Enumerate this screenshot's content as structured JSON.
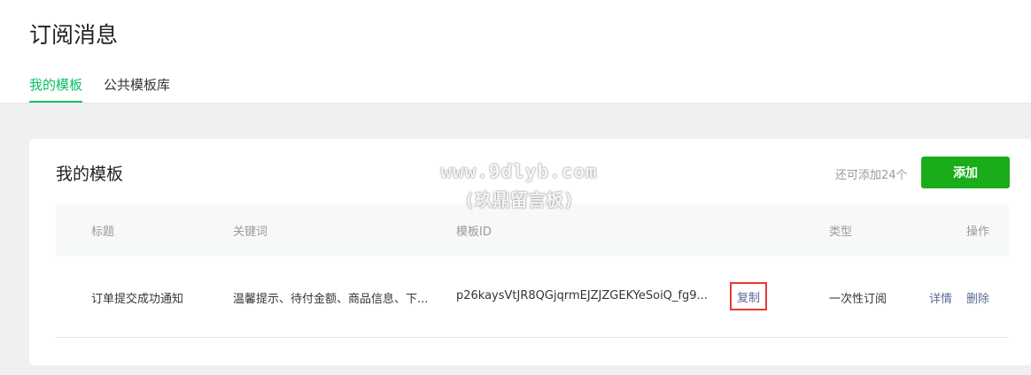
{
  "page": {
    "title": "订阅消息",
    "tabs": [
      {
        "label": "我的模板",
        "active": true
      },
      {
        "label": "公共模板库",
        "active": false
      }
    ]
  },
  "card": {
    "title": "我的模板",
    "remaining_text": "还可添加24个",
    "add_label": "添加"
  },
  "table": {
    "columns": [
      "标题",
      "关键词",
      "模板ID",
      "类型",
      "操作"
    ],
    "rows": [
      {
        "title": "订单提交成功通知",
        "keywords": "温馨提示、待付金额、商品信息、下...",
        "template_id": "p26kaysVtJR8QGjqrmEJZJZGEKYeSoiQ_fg9...",
        "copy_label": "复制",
        "type": "一次性订阅",
        "actions": [
          "详情",
          "删除"
        ]
      }
    ]
  },
  "watermark": {
    "line1": "www.9dlyb.com",
    "line2": "(玖鼎留言板)"
  },
  "colors": {
    "accent": "#07c160",
    "button": "#1aad19",
    "link": "#576b95",
    "highlight_box": "#e53935"
  }
}
